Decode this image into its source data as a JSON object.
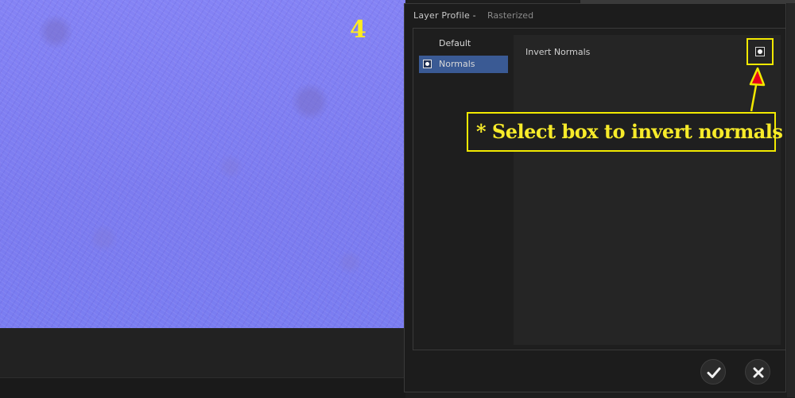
{
  "canvas": {
    "step_number": "4"
  },
  "dialog": {
    "title": "Layer Profile -",
    "subtitle": "Rasterized",
    "profiles": [
      {
        "label": "Default",
        "selected": false
      },
      {
        "label": "Normals",
        "selected": true
      }
    ],
    "settings": {
      "invert_normals_label": "Invert Normals",
      "invert_normals_checked": true
    },
    "buttons": {
      "ok_icon": "checkmark-icon",
      "close_icon": "close-icon"
    }
  },
  "annotation": {
    "callout_text": "* Select box to invert normals"
  },
  "colors": {
    "annotation_yellow": "#f2e900",
    "selection_blue": "#3a5a94",
    "normal_map_base": "#7f7ff2"
  }
}
